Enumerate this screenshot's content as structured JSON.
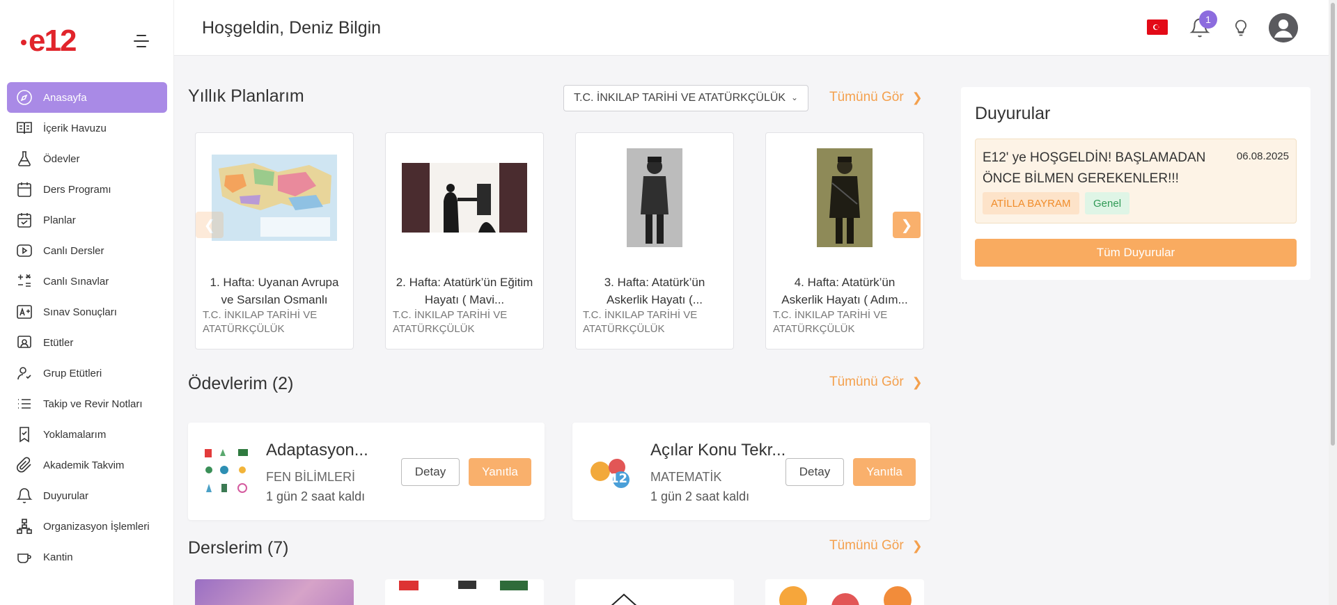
{
  "app": {
    "logo_text": "e12"
  },
  "header": {
    "greeting": "Hoşgeldin, Deniz Bilgin",
    "notification_count": "1",
    "flag_color": "#e30a17"
  },
  "sidebar": {
    "items": [
      {
        "label": "Anasayfa",
        "icon": "compass-icon",
        "active": true
      },
      {
        "label": "İçerik Havuzu",
        "icon": "book-open-icon"
      },
      {
        "label": "Ödevler",
        "icon": "flask-icon"
      },
      {
        "label": "Ders Programı",
        "icon": "calendar-icon"
      },
      {
        "label": "Planlar",
        "icon": "calendar-check-icon"
      },
      {
        "label": "Canlı Dersler",
        "icon": "play-icon"
      },
      {
        "label": "Canlı Sınavlar",
        "icon": "math-ops-icon"
      },
      {
        "label": "Sınav Sonuçları",
        "icon": "grade-a-plus-icon"
      },
      {
        "label": "Etütler",
        "icon": "presentation-icon"
      },
      {
        "label": "Grup Etütleri",
        "icon": "group-user-icon"
      },
      {
        "label": "Takip ve Revir Notları",
        "icon": "list-icon"
      },
      {
        "label": "Yoklamalarım",
        "icon": "bookmark-check-icon"
      },
      {
        "label": "Akademik Takvim",
        "icon": "paperclip-icon"
      },
      {
        "label": "Duyurular",
        "icon": "bell-icon"
      },
      {
        "label": "Organizasyon İşlemleri",
        "icon": "org-chart-icon"
      },
      {
        "label": "Kantin",
        "icon": "cup-icon"
      }
    ]
  },
  "plans": {
    "title": "Yıllık Planlarım",
    "subject_select": "T.C. İNKILAP TARİHİ VE ATATÜRKÇÜLÜK",
    "see_all": "Tümünü Gör",
    "cards": [
      {
        "title": "1. Hafta: Uyanan Avrupa ve Sarsılan Osmanlı",
        "subject": "T.C. İNKILAP TARİHİ VE ATATÜRKÇÜLÜK",
        "image": "map"
      },
      {
        "title": "2. Hafta: Atatürk’ün Eğitim Hayatı ( Mavi...",
        "subject": "T.C. İNKILAP TARİHİ VE ATATÜRKÇÜLÜK",
        "image": "classroom"
      },
      {
        "title": "3. Hafta: Atatürk’ün Askerlik Hayatı (...",
        "subject": "T.C. İNKILAP TARİHİ VE ATATÜRKÇÜLÜK",
        "image": "soldier-bw"
      },
      {
        "title": "4. Hafta: Atatürk’ün Askerlik Hayatı ( Adım...",
        "subject": "T.C. İNKILAP TARİHİ VE ATATÜRKÇÜLÜK",
        "image": "soldier-sepia"
      }
    ]
  },
  "homework": {
    "title": "Ödevlerim (2)",
    "see_all": "Tümünü Gör",
    "items": [
      {
        "title": "Adaptasyon...",
        "subject": "FEN BİLİMLERİ",
        "remaining": "1 gün 2 saat kaldı",
        "detail": "Detay",
        "reply": "Yanıtla"
      },
      {
        "title": "Açılar Konu Tekr...",
        "subject": "MATEMATİK",
        "remaining": "1 gün 2 saat kaldı",
        "detail": "Detay",
        "reply": "Yanıtla"
      }
    ]
  },
  "courses": {
    "title": "Derslerim (7)",
    "see_all": "Tümünü Gör"
  },
  "announcements": {
    "title": "Duyurular",
    "items": [
      {
        "text": "E12' ye HOŞGELDİN! BAŞLAMADAN ÖNCE BİLMEN GEREKENLER!!!",
        "date": "06.08.2025",
        "author": "ATİLLA BAYRAM",
        "category": "Genel"
      }
    ],
    "all_button": "Tüm Duyurular"
  },
  "colors": {
    "accent": "#f9b06c",
    "active_menu": "#a98ae6",
    "badge": "#8c6cde",
    "brand": "#e1242b"
  }
}
